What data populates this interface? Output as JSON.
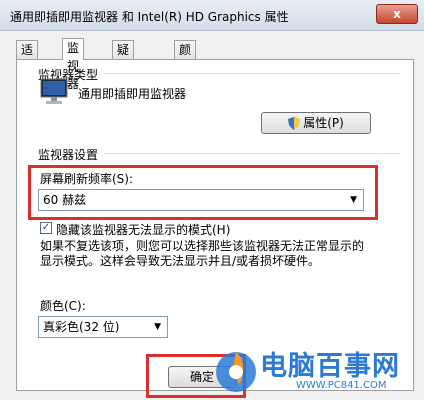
{
  "window": {
    "title": "通用即插即用监视器 和 Intel(R) HD Graphics 属性",
    "close_label": "x"
  },
  "tabs": [
    {
      "label": "适配器",
      "active": false
    },
    {
      "label": "监视器",
      "active": true
    },
    {
      "label": "疑难解答",
      "active": false
    },
    {
      "label": "颜色管理",
      "active": false
    }
  ],
  "monitor_type": {
    "heading": "监视器类型",
    "name": "通用即插即用监视器",
    "properties_button": "属性(P)"
  },
  "monitor_settings": {
    "heading": "监视器设置",
    "refresh_label": "屏幕刷新频率(S):",
    "refresh_value": "60 赫兹",
    "hide_modes_label": "隐藏该监视器无法显示的模式(H)",
    "hide_modes_checked": true,
    "description_line1": "如果不复选该项，则您可以选择那些该监视器无法正常显示的",
    "description_line2": "显示模式。这样会导致无法显示并且/或者损坏硬件。"
  },
  "color": {
    "label": "颜色(C):",
    "value": "真彩色(32 位)"
  },
  "footer": {
    "ok_button": "确定"
  },
  "watermark": {
    "brand": "电脑百事网",
    "url": "WWW.PC841.COM"
  },
  "colors": {
    "highlight_box": "#d9302c",
    "watermark_blue": "#2a7ad6",
    "watermark_orange": "#f39a1e"
  }
}
